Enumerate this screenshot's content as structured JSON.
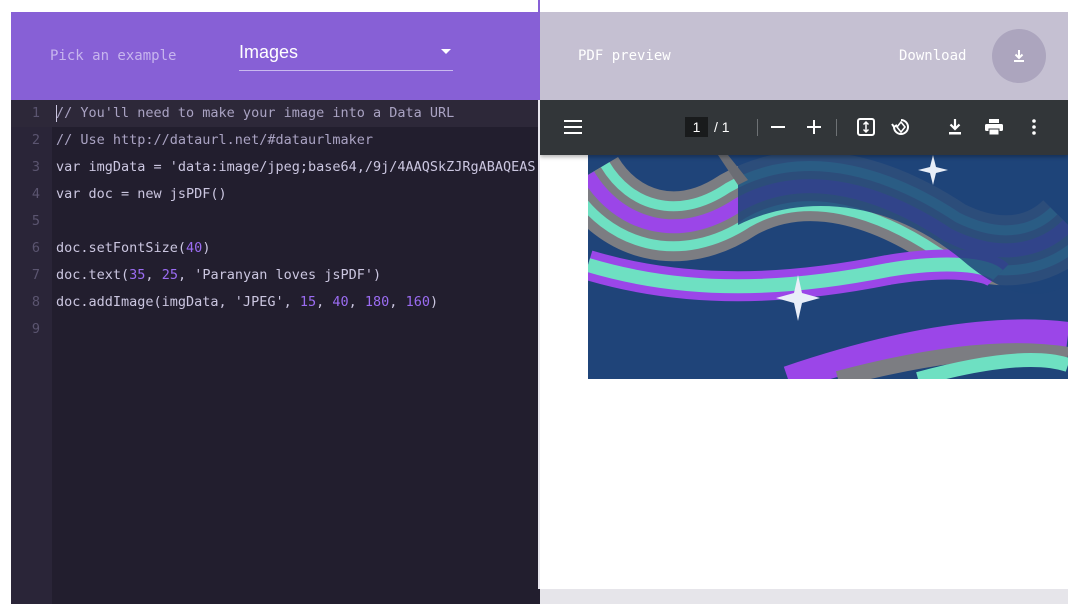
{
  "left_panel": {
    "pick_label": "Pick an example",
    "select": {
      "value": "Images",
      "icon": "caret-down-icon"
    }
  },
  "editor": {
    "lines": [
      {
        "number": "1",
        "text": "// You'll need to make your image into a Data URL"
      },
      {
        "number": "2",
        "text": "// Use http://dataurl.net/#dataurlmaker"
      },
      {
        "number": "3",
        "text": "var imgData = 'data:image/jpeg;base64,/9j/4AAQSkZJRgABAQEAS"
      },
      {
        "number": "4",
        "text": "var doc = new jsPDF()"
      },
      {
        "number": "5",
        "text": ""
      },
      {
        "number": "6",
        "text": "doc.setFontSize(40)"
      },
      {
        "number": "7",
        "text": "doc.text(35, 25, 'Paranyan loves jsPDF')"
      },
      {
        "number": "8",
        "text": "doc.addImage(imgData, 'JPEG', 15, 40, 180, 160)"
      },
      {
        "number": "9",
        "text": ""
      }
    ],
    "colors": {
      "background": "#221e2e",
      "number": "#9b6cf2",
      "comment": "#aaa3c3",
      "text": "#cbc6e0"
    }
  },
  "right_panel": {
    "preview_label": "PDF preview",
    "download_label": "Download",
    "download_icon": "download-icon"
  },
  "pdf_viewer": {
    "current_page": "1",
    "page_total": "/ 1",
    "icons": [
      "menu-icon",
      "zoom-out-icon",
      "zoom-in-icon",
      "fit-page-icon",
      "rotate-icon",
      "download-icon",
      "print-icon",
      "more-vert-icon"
    ]
  },
  "colors": {
    "accent_purple": "#8760d6",
    "preview_header": "#c5c0d2",
    "viewer_toolbar": "#323639"
  }
}
